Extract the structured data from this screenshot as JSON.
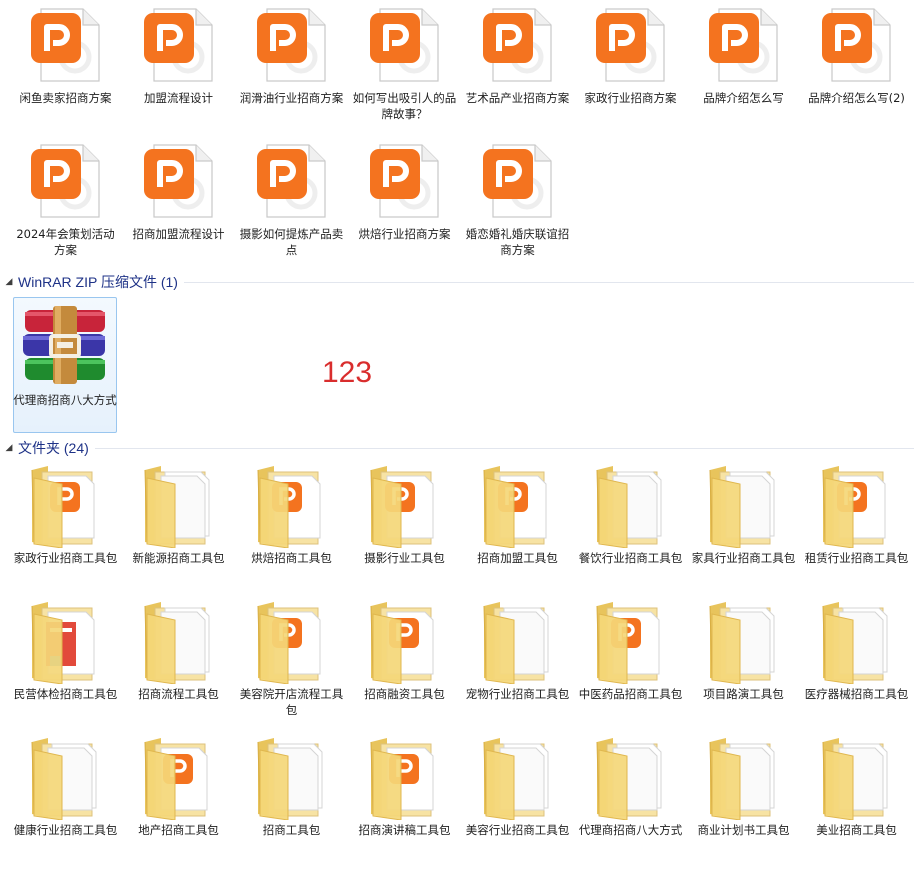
{
  "colors": {
    "accent_orange": "#f4731f",
    "section_title": "#1e3287",
    "overlay_red": "#d92d2d",
    "folder_yellow": "#f2d57a"
  },
  "icons": {
    "document": "ppt-orange-p-icon",
    "archive": "winrar-books-icon",
    "folder": "folder-icon"
  },
  "documents": [
    "闲鱼卖家招商方案",
    "加盟流程设计",
    "润滑油行业招商方案",
    "如何写出吸引人的品牌故事？",
    "艺术品产业招商方案",
    "家政行业招商方案",
    "品牌介绍怎么写",
    "品牌介绍怎么写(2)",
    "2024年会策划活动方案",
    "招商加盟流程设计",
    "摄影如何提炼产品卖点",
    "烘焙行业招商方案",
    "婚恋婚礼婚庆联谊招商方案"
  ],
  "zip_section": {
    "title": "WinRAR ZIP 压缩文件 (1)",
    "items": [
      "代理商招商八大方式"
    ]
  },
  "overlay_text": "123",
  "folder_section": {
    "title": "文件夹 (24)",
    "items": [
      {
        "label": "家政行业招商工具包",
        "inner": "ppt"
      },
      {
        "label": "新能源招商工具包",
        "inner": "pages"
      },
      {
        "label": "烘焙招商工具包",
        "inner": "ppt-side"
      },
      {
        "label": "摄影行业工具包",
        "inner": "ppt-side"
      },
      {
        "label": "招商加盟工具包",
        "inner": "ppt-side"
      },
      {
        "label": "餐饮行业招商工具包",
        "inner": "pages"
      },
      {
        "label": "家具行业招商工具包",
        "inner": "pages"
      },
      {
        "label": "租赁行业招商工具包",
        "inner": "ppt-side"
      },
      {
        "label": "民营体检招商工具包",
        "inner": "brochure"
      },
      {
        "label": "招商流程工具包",
        "inner": "pages"
      },
      {
        "label": "美容院开店流程工具包",
        "inner": "ppt-side"
      },
      {
        "label": "招商融资工具包",
        "inner": "ppt"
      },
      {
        "label": "宠物行业招商工具包",
        "inner": "pages"
      },
      {
        "label": "中医药品招商工具包",
        "inner": "ppt-side"
      },
      {
        "label": "项目路演工具包",
        "inner": "pages"
      },
      {
        "label": "医疗器械招商工具包",
        "inner": "pages"
      },
      {
        "label": "健康行业招商工具包",
        "inner": "pages"
      },
      {
        "label": "地产招商工具包",
        "inner": "ppt"
      },
      {
        "label": "招商工具包",
        "inner": "pages"
      },
      {
        "label": "招商演讲稿工具包",
        "inner": "ppt"
      },
      {
        "label": "美容行业招商工具包",
        "inner": "pages"
      },
      {
        "label": "代理商招商八大方式",
        "inner": "pages"
      },
      {
        "label": "商业计划书工具包",
        "inner": "pages"
      },
      {
        "label": "美业招商工具包",
        "inner": "pages"
      }
    ]
  }
}
